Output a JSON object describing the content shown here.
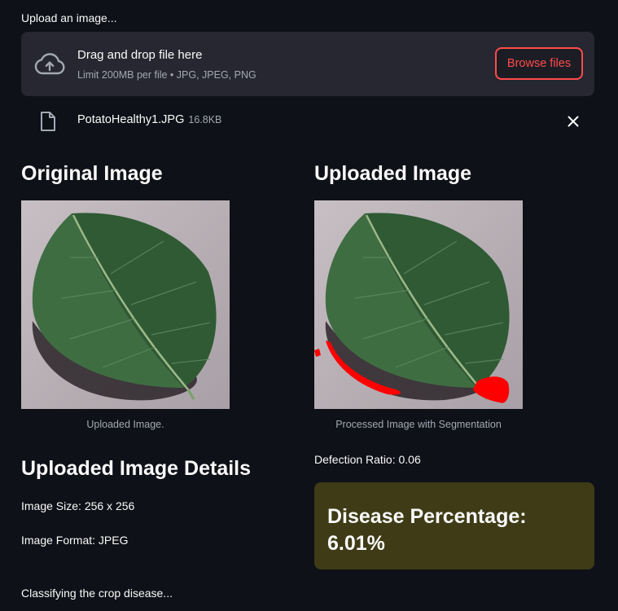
{
  "uploader": {
    "label": "Upload an image...",
    "drop_title": "Drag and drop file here",
    "drop_limit": "Limit 200MB per file • JPG, JPEG, PNG",
    "browse_label": "Browse files",
    "accent_color": "#ff4b4b"
  },
  "file": {
    "name": "PotatoHealthy1.JPG",
    "size": "16.8KB"
  },
  "original": {
    "heading": "Original Image",
    "caption": "Uploaded Image."
  },
  "uploaded": {
    "heading": "Uploaded Image",
    "caption": "Processed Image with Segmentation",
    "segment_color": "#ff0000"
  },
  "details": {
    "heading": "Uploaded Image Details",
    "size": "Image Size: 256 x 256",
    "format": "Image Format: JPEG"
  },
  "defection": "Defection Ratio: 0.06",
  "disease": {
    "text": "Disease Percentage: 6.01%",
    "bg_color": "#3e3b16"
  },
  "status": "Classifying the crop disease..."
}
